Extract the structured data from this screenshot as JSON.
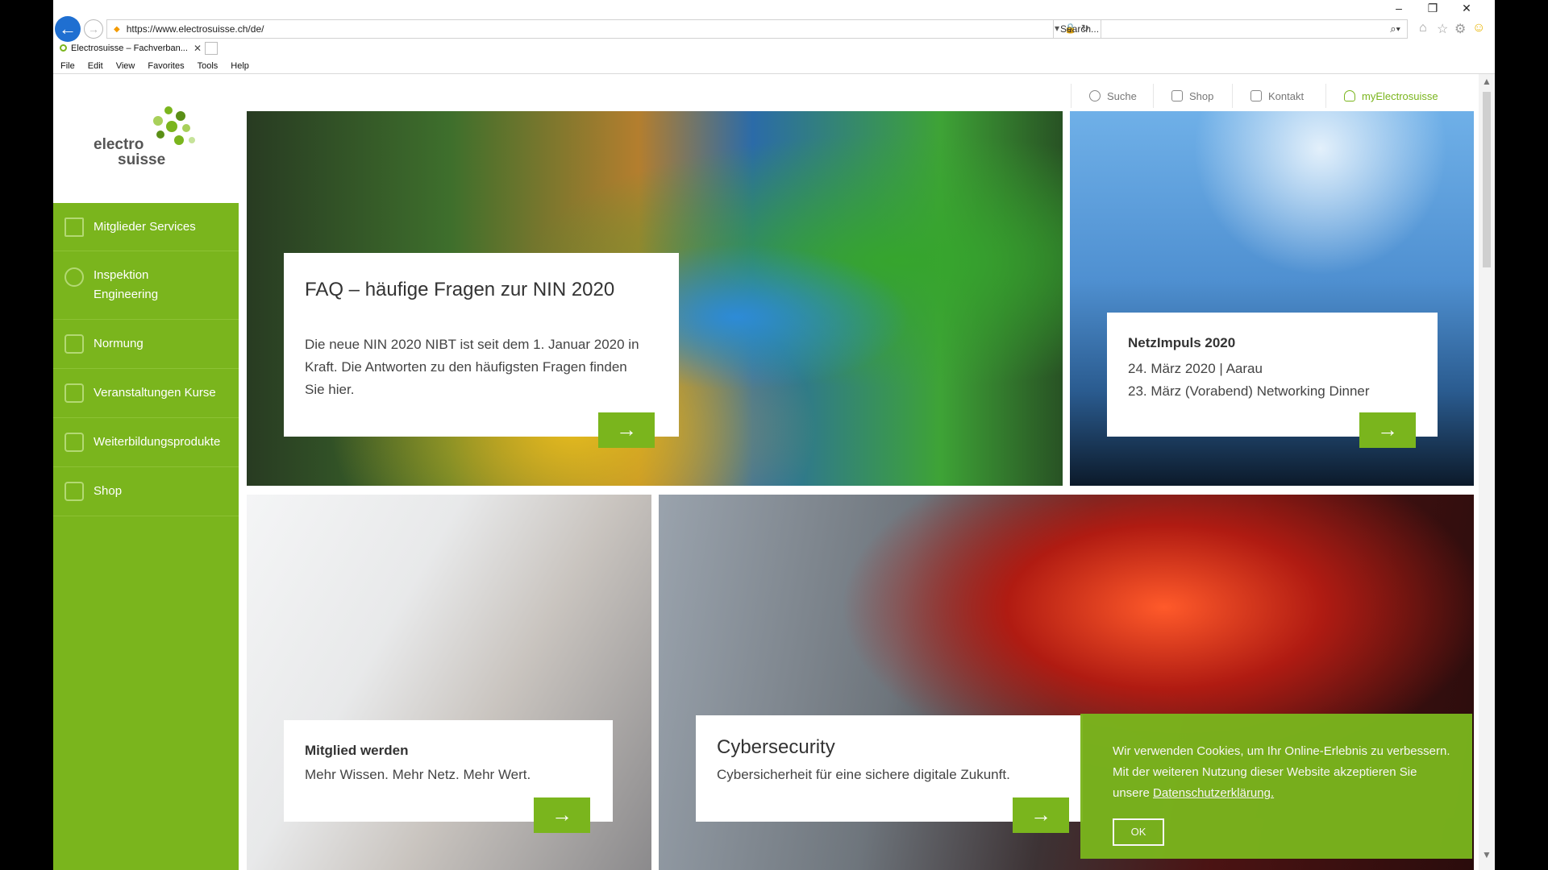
{
  "browser": {
    "url": "https://www.electrosuisse.ch/de/",
    "search_placeholder": "Search...",
    "tab_title": "Electrosuisse – Fachverban...",
    "menu": [
      "File",
      "Edit",
      "View",
      "Favorites",
      "Tools",
      "Help"
    ],
    "window_controls": [
      "–",
      "❐",
      "✕"
    ]
  },
  "header": {
    "logo_line1": "electro",
    "logo_line2": "suisse",
    "util_links": [
      "Suche",
      "Shop",
      "Kontakt",
      "myElectrosuisse"
    ]
  },
  "sidebar": {
    "items": [
      {
        "label": "Mitglieder Services"
      },
      {
        "label": "Inspektion Engineering"
      },
      {
        "label": "Normung"
      },
      {
        "label": "Veranstaltungen Kurse"
      },
      {
        "label": "Weiterbildungsprodukte"
      },
      {
        "label": "Shop"
      }
    ]
  },
  "tiles": {
    "faq": {
      "title": "FAQ – häufige Fragen zur NIN 2020",
      "text": "Die neue NIN 2020 NIBT ist seit dem 1. Januar 2020 in Kraft. Die Antworten zu den häufigsten Fragen finden Sie hier."
    },
    "netz": {
      "title": "NetzImpuls 2020",
      "line1": "24. März 2020 | Aarau",
      "line2": "23. März (Vorabend) Networking Dinner"
    },
    "mitglied": {
      "title": "Mitglied werden",
      "text": "Mehr Wissen. Mehr Netz. Mehr Wert."
    },
    "cyber": {
      "title": "Cybersecurity",
      "text": "Cybersicherheit für eine sichere digitale Zukunft."
    },
    "arrow": "→"
  },
  "cookie": {
    "text": "Wir verwenden Cookies, um Ihr Online-Erlebnis zu verbessern. Mit der weiteren Nutzung dieser Website akzeptieren Sie unsere",
    "link": "Datenschutzerklärung.",
    "ok": "OK"
  },
  "colors": {
    "brand_green": "#7ab51d",
    "back_button_blue": "#1f6fd1"
  }
}
